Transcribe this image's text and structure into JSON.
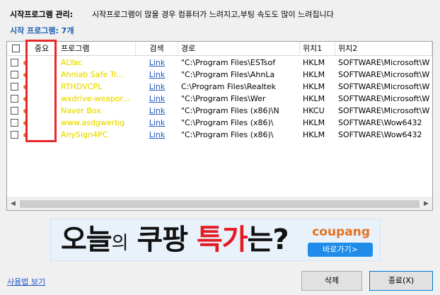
{
  "header": {
    "title_label": "시작프로그램 관리:",
    "message": "시작프로그램이 많을 경우 컴퓨터가 느려지고,부팅 속도도 많이 느려집니다",
    "count_prefix": "시작 프로그램:",
    "count_value": "7개"
  },
  "table": {
    "columns": [
      "중요",
      "프로그램",
      "검색",
      "경로",
      "위치1",
      "위치2"
    ],
    "rows": [
      {
        "program": "ALYac",
        "search": "Link",
        "path": "\"C:\\Program Files\\ESTsof",
        "loc1": "HKLM",
        "loc2": "SOFTWARE\\Microsoft\\W"
      },
      {
        "program": "Ahnlab Safe Tr...",
        "search": "Link",
        "path": "\"C:\\Program Files\\AhnLa",
        "loc1": "HKLM",
        "loc2": "SOFTWARE\\Microsoft\\W"
      },
      {
        "program": "RTHDVCPL",
        "search": "Link",
        "path": "C:\\Program Files\\Realtek",
        "loc1": "HKLM",
        "loc2": "SOFTWARE\\Microsoft\\W"
      },
      {
        "program": "wxdrive-weapor...",
        "search": "Link",
        "path": "\"C:\\Program Files\\Wer",
        "loc1": "HKLM",
        "loc2": "SOFTWARE\\Microsoft\\W"
      },
      {
        "program": "Naver Box",
        "search": "Link",
        "path": "\"C:\\Program Files (x86)\\N",
        "loc1": "HKCU",
        "loc2": "SOFTWARE\\Microsoft\\W"
      },
      {
        "program": "www.asdgwerbg",
        "search": "Link",
        "path": "\"C:\\Program Files (x86)\\",
        "loc1": "HKLM",
        "loc2": "SOFTWARE\\Wow6432"
      },
      {
        "program": "AnySign4PC",
        "search": "Link",
        "path": "\"C:\\Program Files (x86)\\",
        "loc1": "HKLM",
        "loc2": "SOFTWARE\\Wow6432"
      }
    ]
  },
  "ad": {
    "main_a": "오늘",
    "main_b": "의",
    "main_c": " 쿠팡 ",
    "main_d": "특가",
    "main_e": "는?",
    "brand": "coupang",
    "button": "바로가기>"
  },
  "footer": {
    "usage_link": "사용법 보기",
    "delete_button": "삭제",
    "close_button": "종료(X)"
  },
  "colors": {
    "accent_blue": "#1a5fb4",
    "important_dot": "#f07424",
    "highlight_box": "#e8282a"
  }
}
